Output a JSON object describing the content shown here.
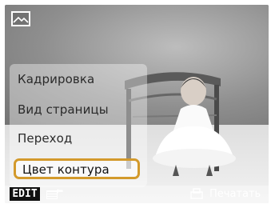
{
  "menu": {
    "items": [
      "Кадрировка",
      "Вид страницы",
      "Переход"
    ],
    "selected": "Цвет контура"
  },
  "bottom": {
    "edit_label": "EDIT",
    "print_label": "Печатать"
  },
  "colors": {
    "selection_border": "#d39a2c"
  },
  "icons": [
    "image-icon",
    "list-icon",
    "back-arrow-icon",
    "print-icon"
  ]
}
